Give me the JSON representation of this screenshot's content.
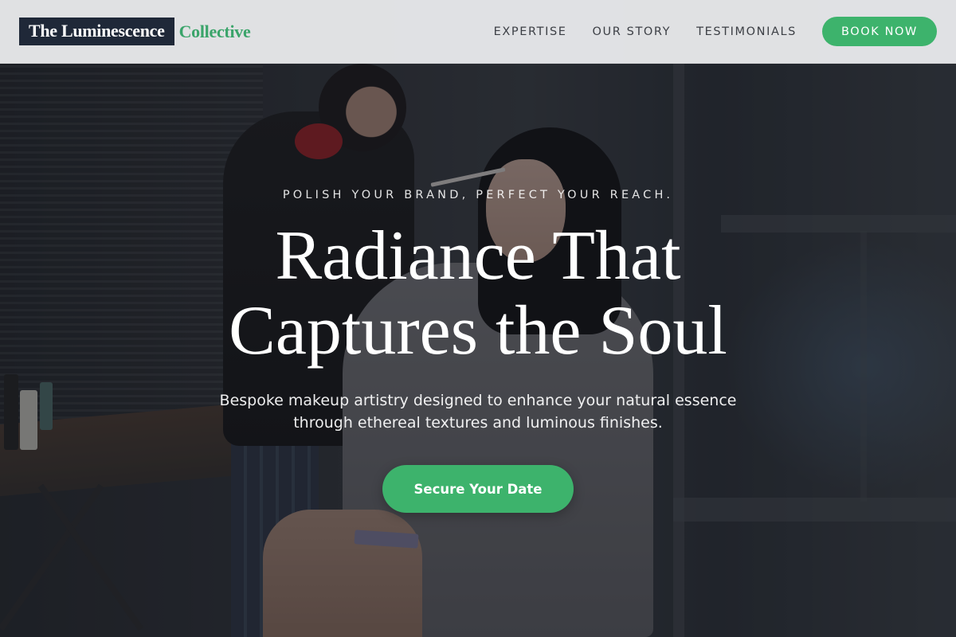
{
  "brand": {
    "name_main": "The Luminescence",
    "name_accent": "Collective",
    "accent_color": "#3aa46a",
    "main_bg_color": "#1f2838"
  },
  "nav": {
    "links": [
      "EXPERTISE",
      "OUR STORY",
      "TESTIMONIALS"
    ],
    "cta_label": "BOOK NOW",
    "cta_color": "#3db36c"
  },
  "hero": {
    "eyebrow": "POLISH YOUR BRAND, PERFECT YOUR REACH.",
    "headline_line1": "Radiance That",
    "headline_line2": "Captures the Soul",
    "subhead_line1": "Bespoke makeup artistry designed to enhance your natural essence",
    "subhead_line2": "through ethereal textures and luminous finishes.",
    "cta_label": "Secure Your Date",
    "cta_color": "#3db36c"
  }
}
